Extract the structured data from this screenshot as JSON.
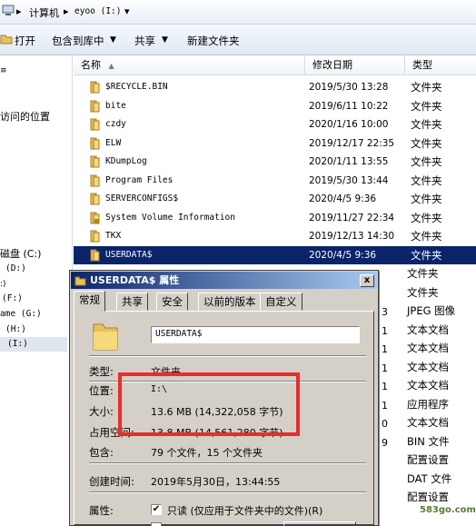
{
  "address": {
    "parts": [
      "计算机",
      "eyoo (I:)"
    ]
  },
  "toolbar": {
    "open": "打开",
    "include": "包含到库中",
    "share": "共享",
    "new_folder": "新建文件夹"
  },
  "nav": {
    "items": [
      "访问的位置",
      "磁盘 (C:)",
      "(D:)",
      "(F:)",
      "ame (G:)",
      "(H:)",
      "(I:)"
    ]
  },
  "columns": {
    "name": "名称",
    "date": "修改日期",
    "type": "类型"
  },
  "files": [
    {
      "name": "$RECYCLE.BIN",
      "date": "2019/5/30 13:28",
      "type": "文件夹"
    },
    {
      "name": "bite",
      "date": "2019/6/11 10:22",
      "type": "文件夹"
    },
    {
      "name": "czdy",
      "date": "2020/1/16 10:00",
      "type": "文件夹"
    },
    {
      "name": "ELW",
      "date": "2019/12/17 22:35",
      "type": "文件夹"
    },
    {
      "name": "KDumpLog",
      "date": "2020/1/11 13:55",
      "type": "文件夹"
    },
    {
      "name": "Program Files",
      "date": "2019/5/30 13:44",
      "type": "文件夹"
    },
    {
      "name": "SERVERCONFIGS$",
      "date": "2020/4/5 9:36",
      "type": "文件夹"
    },
    {
      "name": "System Volume Information",
      "date": "2019/11/27 22:34",
      "type": "文件夹"
    },
    {
      "name": "TKX",
      "date": "2019/12/13 14:30",
      "type": "文件夹"
    },
    {
      "name": "USERDATA$",
      "date": "2020/4/5 9:36",
      "type": "文件夹"
    }
  ],
  "tail_types": [
    "文件夹",
    "文件夹",
    "JPEG 图像",
    "文本文档",
    "文本文档",
    "文本文档",
    "文本文档",
    "应用程序",
    "文本文档",
    "BIN 文件",
    "配置设置",
    "DAT 文件",
    "配置设置"
  ],
  "tail_dates": [
    "3",
    "1",
    "1",
    "1",
    "1",
    "1",
    "0",
    "9"
  ],
  "dialog": {
    "title": "USERDATA$ 属性",
    "close": "x",
    "tabs": [
      "常规",
      "共享",
      "安全",
      "以前的版本",
      "自定义"
    ],
    "folder_name": "USERDATA$",
    "type_label": "类型:",
    "type_value": "文件夹",
    "location_label": "位置:",
    "location_value": "I:\\",
    "size_label": "大小:",
    "size_value": "13.6 MB (14,322,058 字节)",
    "ondisk_label": "占用空间:",
    "ondisk_value": "13.8 MB (14,561,280 字节)",
    "contains_label": "包含:",
    "contains_value": "79 个文件，15 个文件夹",
    "created_label": "创建时间:",
    "created_value": "2019年5月30日，13:44:55",
    "attr_label": "属性:",
    "readonly_label": "只读 (仅应用于文件夹中的文件)(R)",
    "hidden_label": "隐藏(H)",
    "advanced_label": "高级(D)..."
  },
  "watermark": "583go.com",
  "colors": {
    "selection": "#0a246a",
    "highlight_box": "#ee2b2b",
    "folder": "#e8c25a"
  }
}
